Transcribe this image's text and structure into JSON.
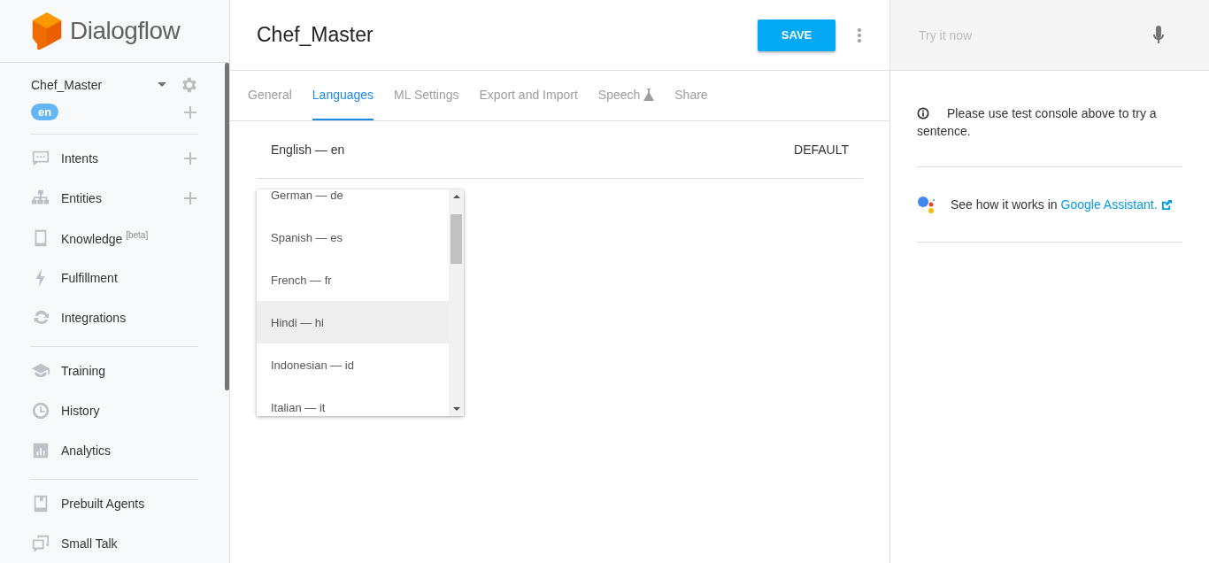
{
  "brand": "Dialogflow",
  "agent": {
    "name": "Chef_Master",
    "language": "en"
  },
  "nav_groups": [
    {
      "items": [
        {
          "kind": "chat",
          "label": "Intents",
          "addable": true
        },
        {
          "kind": "tree",
          "label": "Entities",
          "addable": true
        },
        {
          "kind": "book",
          "label": "Knowledge $^{[beta]}$",
          "addable": false
        },
        {
          "kind": "bolt",
          "label": "Fulfillment",
          "addable": false
        },
        {
          "kind": "sync",
          "label": "Integrations",
          "addable": false
        }
      ]
    },
    {
      "items": [
        {
          "kind": "cap",
          "label": "Training",
          "addable": false
        },
        {
          "kind": "clock",
          "label": "History",
          "addable": false
        },
        {
          "kind": "chart",
          "label": "Analytics",
          "addable": false
        }
      ]
    },
    {
      "items": [
        {
          "kind": "bookmark",
          "label": "Prebuilt Agents",
          "addable": false
        },
        {
          "kind": "talk",
          "label": "Small Talk",
          "addable": false
        }
      ]
    }
  ],
  "header": {
    "title": "Chef_Master",
    "save_button": "SAVE"
  },
  "tabs": [
    {
      "label": "General",
      "selected": false,
      "experimental": false
    },
    {
      "label": "Languages",
      "selected": true,
      "experimental": false
    },
    {
      "label": "ML Settings",
      "selected": false,
      "experimental": false
    },
    {
      "label": "Export and Import",
      "selected": false,
      "experimental": false
    },
    {
      "label": "Speech",
      "selected": false,
      "experimental": true
    },
    {
      "label": "Share",
      "selected": false,
      "experimental": false
    }
  ],
  "languages": [
    {
      "label": "English — en",
      "tag": "DEFAULT"
    }
  ],
  "language_dropdown": {
    "options": [
      {
        "label": "German — de",
        "selected": false
      },
      {
        "label": "Spanish — es",
        "selected": false
      },
      {
        "label": "French — fr",
        "selected": false
      },
      {
        "label": "Hindi — hi",
        "selected": true
      },
      {
        "label": "Indonesian — id",
        "selected": false
      },
      {
        "label": "Italian — it",
        "selected": false
      }
    ]
  },
  "test_console": {
    "placeholder": "Try it now",
    "info": "Please use test console above to try a sentence.",
    "assistant_text": "See how it works in",
    "assistant_link": "Google Assistant."
  }
}
